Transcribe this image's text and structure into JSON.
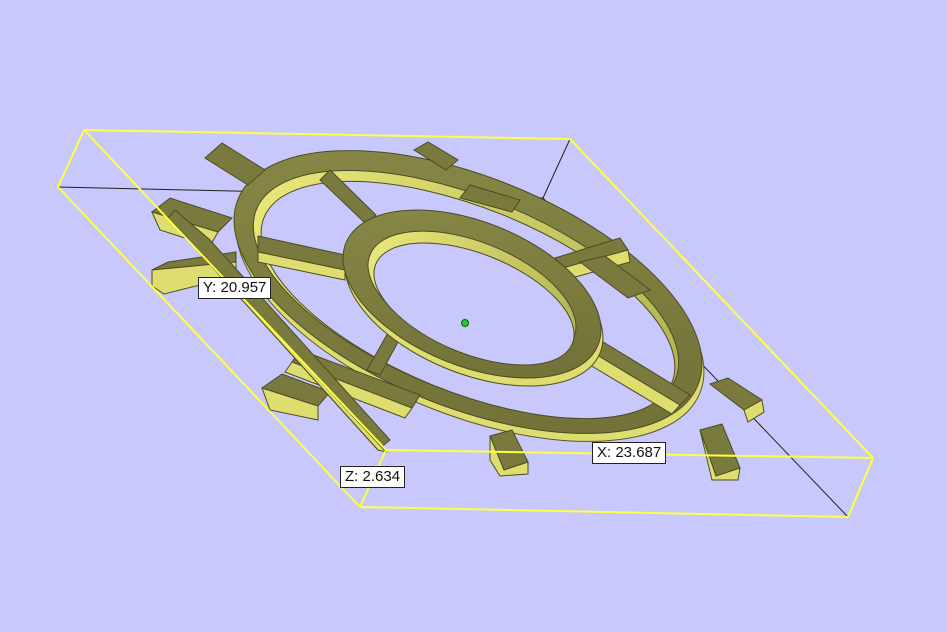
{
  "viewport": {
    "background_color": "#c8c8fc",
    "bounding_box_color": "#ffff44",
    "model_color": "#c8c860",
    "origin_marker_color": "#22cc22"
  },
  "dimensions": {
    "x_label": "X: 23.687",
    "y_label": "Y: 20.957",
    "z_label": "Z: 2.634"
  }
}
